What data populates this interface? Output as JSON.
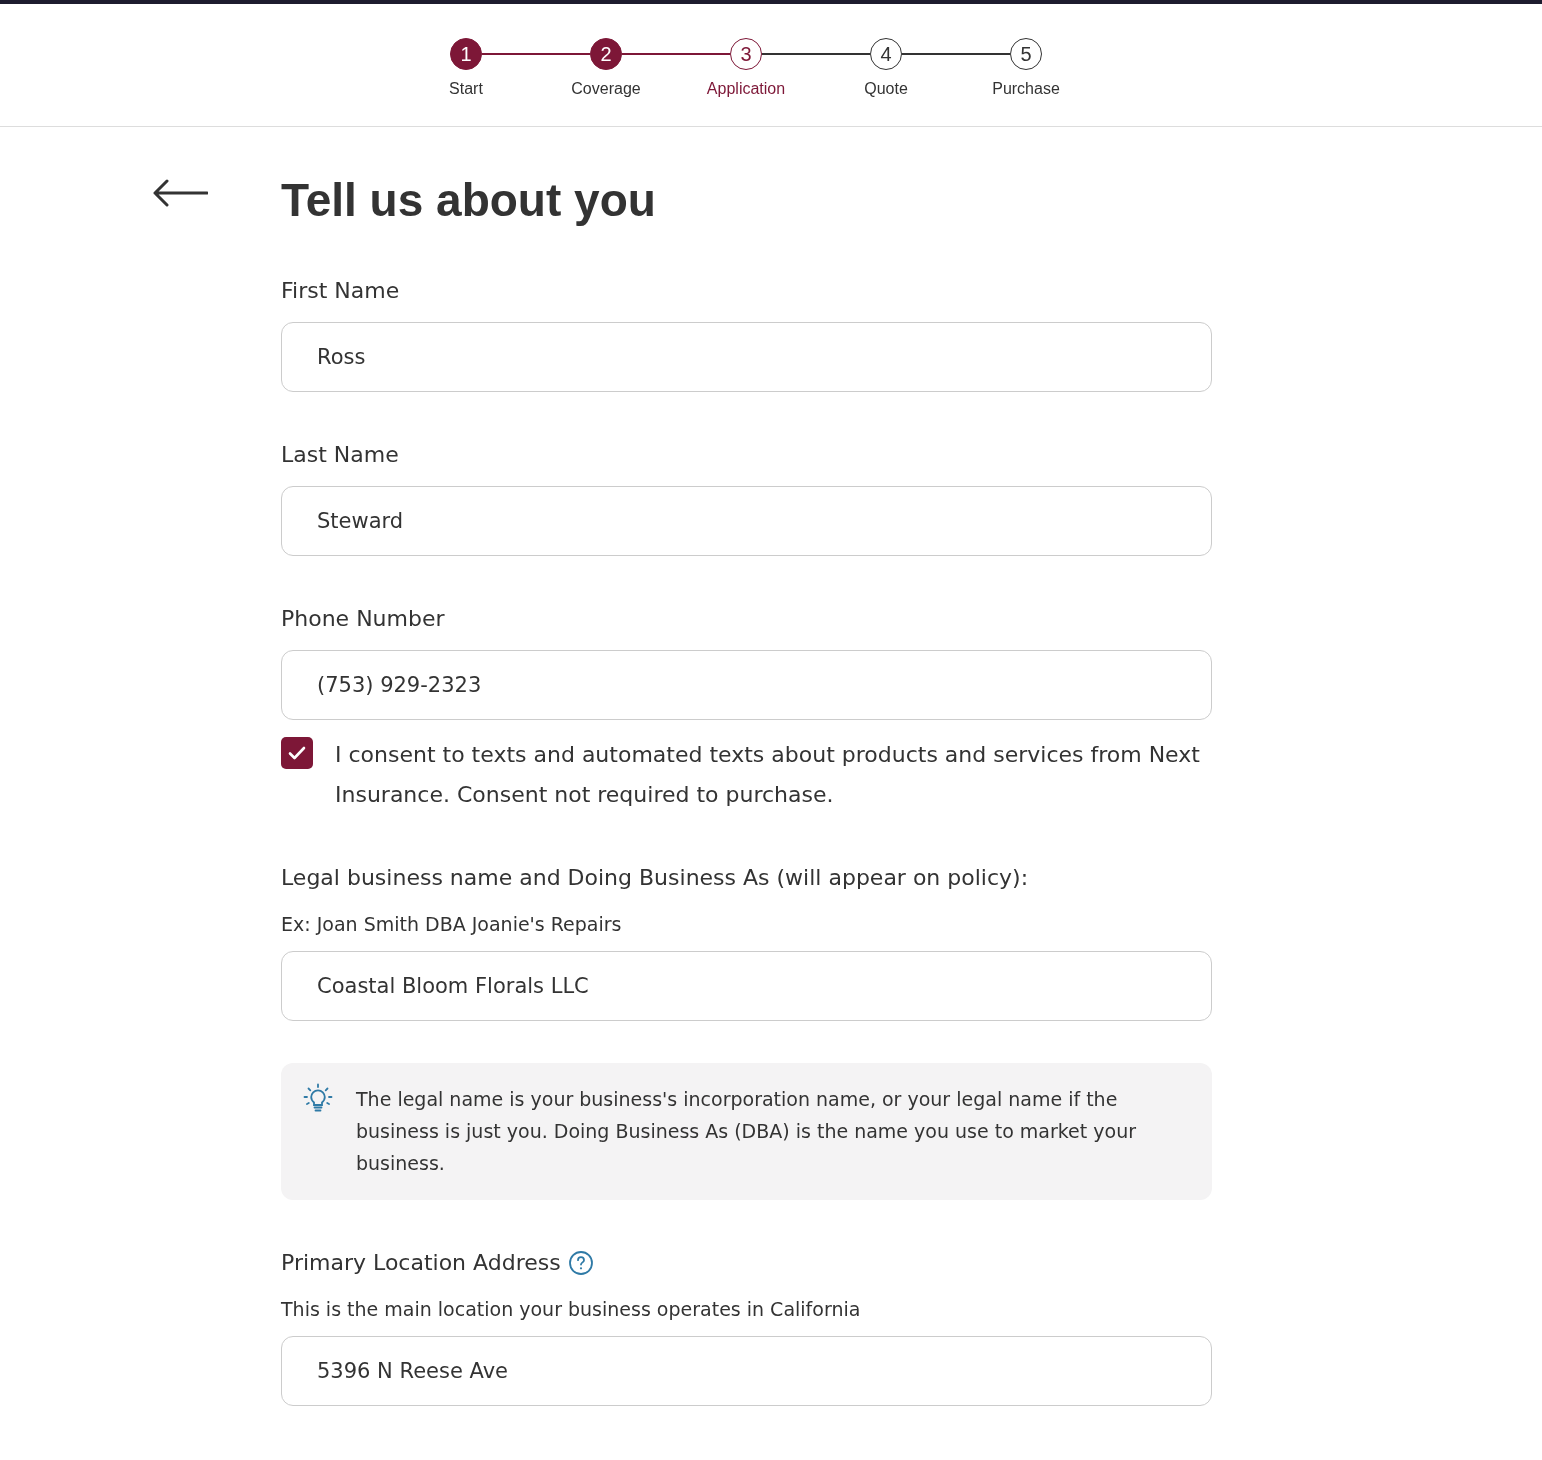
{
  "stepper": {
    "steps": [
      {
        "number": "1",
        "label": "Start",
        "completed": true,
        "selected": false
      },
      {
        "number": "2",
        "label": "Coverage",
        "completed": true,
        "selected": false
      },
      {
        "number": "3",
        "label": "Application",
        "completed": false,
        "selected": true
      },
      {
        "number": "4",
        "label": "Quote",
        "completed": false,
        "selected": false
      },
      {
        "number": "5",
        "label": "Purchase",
        "completed": false,
        "selected": false
      }
    ]
  },
  "page": {
    "title": "Tell us about you"
  },
  "form": [
    {
      "kind": "field",
      "label": "First Name",
      "value": "Ross",
      "help_icon": false
    },
    {
      "kind": "field",
      "label": "Last Name",
      "value": "Steward",
      "help_icon": false
    },
    {
      "kind": "field",
      "label": "Phone Number",
      "value": "(753) 929-2323",
      "help_icon": false
    },
    {
      "kind": "checkbox",
      "checked": true,
      "label": "I consent to texts and automated texts about products and services from Next Insurance. Consent not required to purchase."
    },
    {
      "kind": "field",
      "label": "Legal business name and Doing Business As (will appear on policy):",
      "hint": "Ex: Joan Smith DBA Joanie's Repairs",
      "value": "Coastal Bloom Florals LLC",
      "help_icon": false
    },
    {
      "kind": "tip",
      "text": "The legal name is your business's incorporation name, or your legal name if the business is just you. Doing Business As (DBA) is the name you use to market your business."
    },
    {
      "kind": "field",
      "label": "Primary Location Address",
      "help_icon": true,
      "hint": "This is the main location your business operates in California",
      "value": "5396 N Reese Ave"
    }
  ]
}
